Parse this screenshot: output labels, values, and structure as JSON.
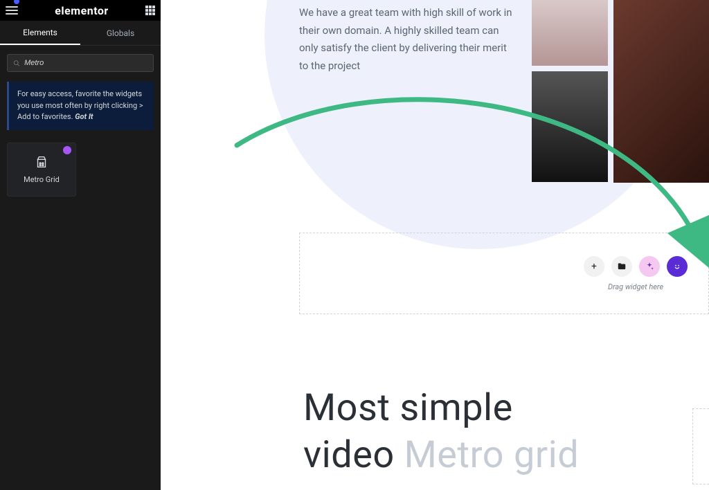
{
  "sidebar": {
    "brand": "elementor",
    "tabs": {
      "elements": "Elements",
      "globals": "Globals"
    },
    "search": {
      "placeholder": "Metro",
      "value": "Metro"
    },
    "tip_text": "For easy access, favorite the widgets you use most often by right clicking > Add to favorites.",
    "tip_cta": "Got It",
    "widgets": [
      {
        "label": "Metro Grid"
      }
    ]
  },
  "canvas": {
    "intro": "We have a great team with high skill of work in their own domain. A highly skilled team can only satisfy the client by delivering their merit to the project",
    "dropzone": {
      "hint": "Drag widget here",
      "buttons": {
        "add": "+",
        "folder": "folder-icon",
        "ai": "sparkle-icon",
        "theme": "theme-icon"
      }
    },
    "headline_a": "Most simple",
    "headline_b": "video ",
    "headline_muted": "Metro grid"
  }
}
